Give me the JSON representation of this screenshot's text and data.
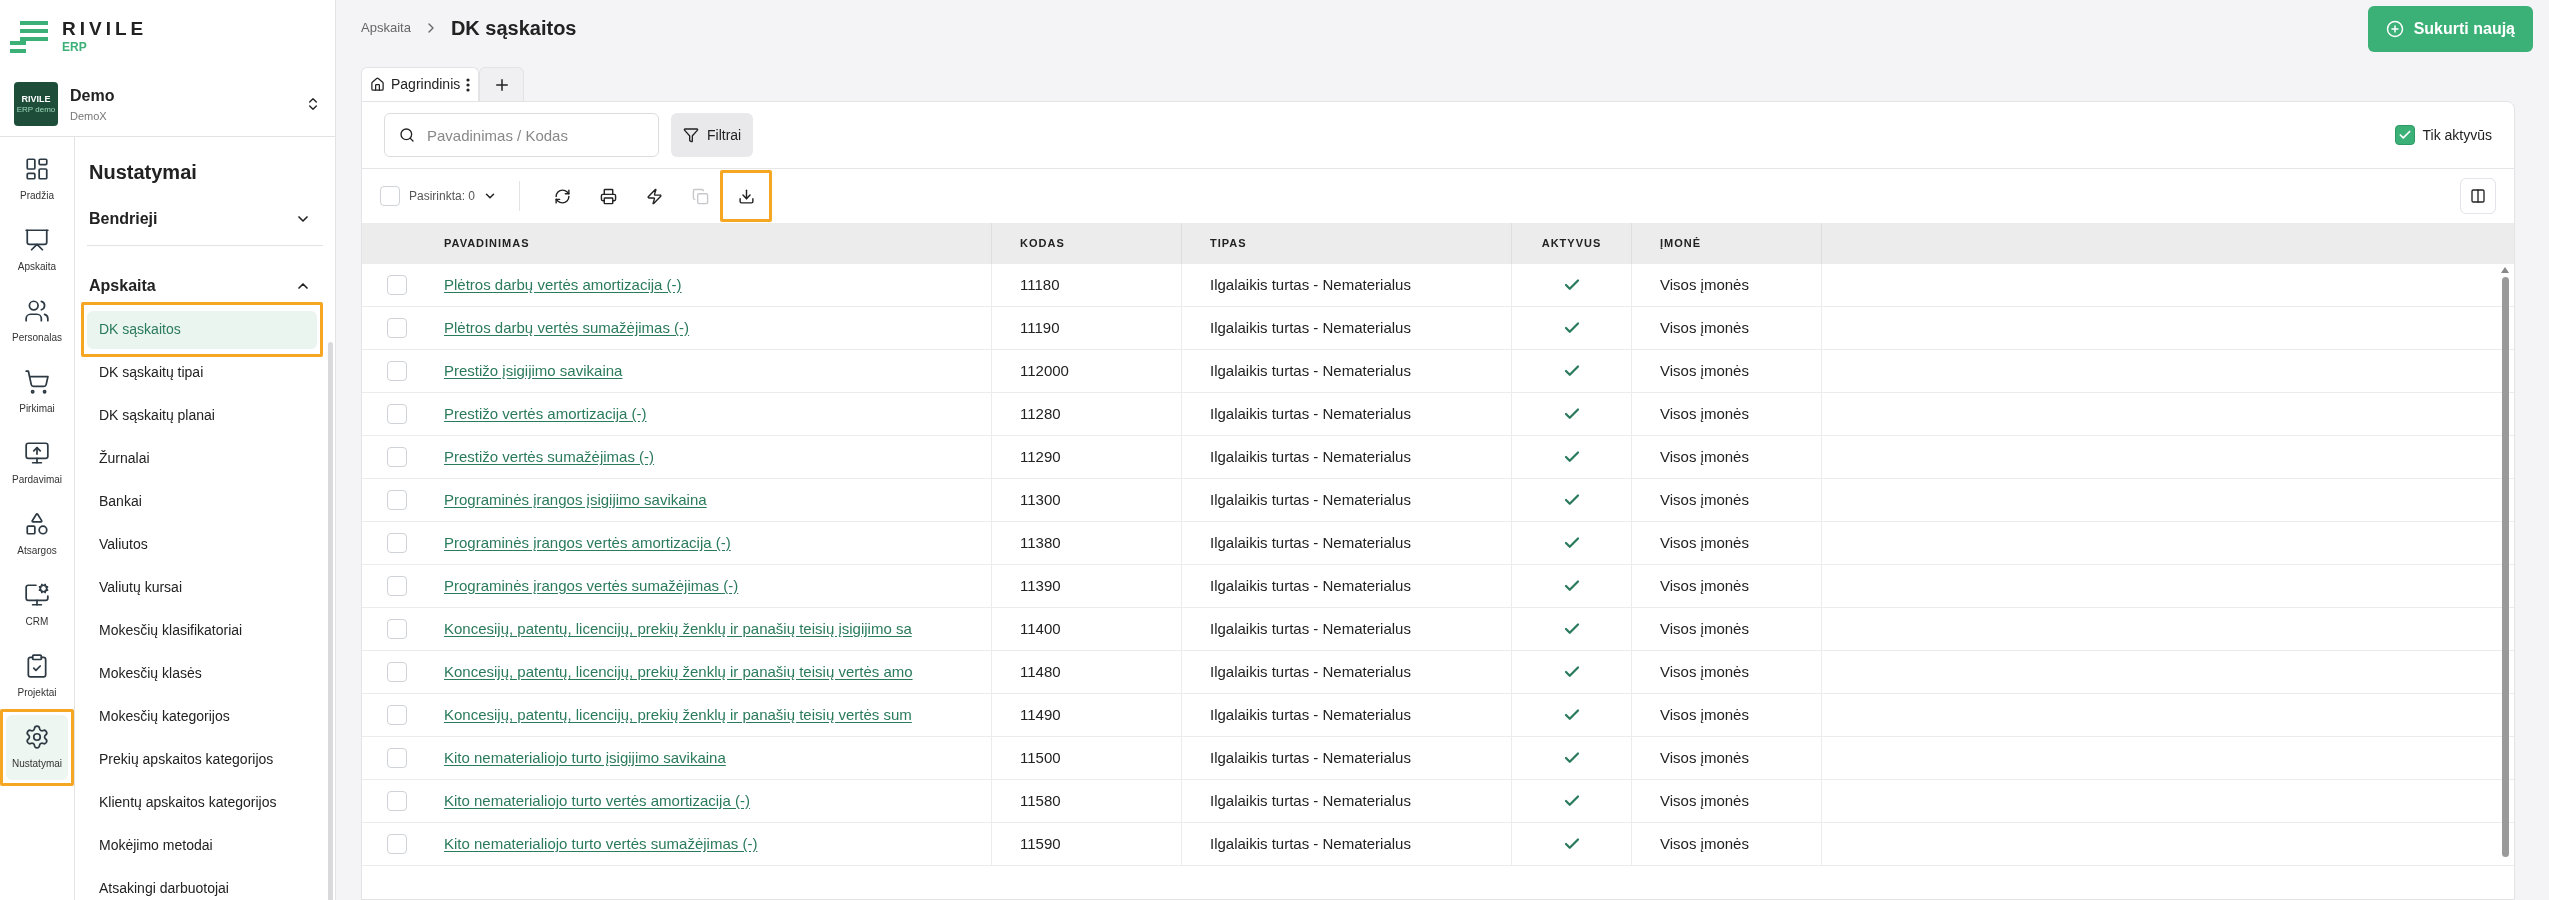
{
  "logo": {
    "name": "RIVILE",
    "sub": "ERP"
  },
  "company": {
    "name": "Demo",
    "sub": "DemoX",
    "logo_text": "RIVILE",
    "logo_caption": "ERP demo"
  },
  "rail": [
    {
      "kind": "dashboard",
      "label": "Pradžia",
      "selected": false,
      "highlighted": false
    },
    {
      "kind": "chart",
      "label": "Apskaita",
      "selected": false,
      "highlighted": false
    },
    {
      "kind": "people",
      "label": "Personalas",
      "selected": false,
      "highlighted": false
    },
    {
      "kind": "cart",
      "label": "Pirkimai",
      "selected": false,
      "highlighted": false
    },
    {
      "kind": "sales",
      "label": "Pardavimai",
      "selected": false,
      "highlighted": false
    },
    {
      "kind": "shapes",
      "label": "Atsargos",
      "selected": false,
      "highlighted": false
    },
    {
      "kind": "crm",
      "label": "CRM",
      "selected": false,
      "highlighted": false
    },
    {
      "kind": "projects",
      "label": "Projektai",
      "selected": false,
      "highlighted": false
    },
    {
      "kind": "settings",
      "label": "Nustatymai",
      "selected": true,
      "highlighted": true
    }
  ],
  "submenu": {
    "title": "Nustatymai",
    "sections": [
      {
        "label": "Bendrieji",
        "expanded": false
      },
      {
        "label": "Apskaita",
        "expanded": true,
        "items": [
          {
            "label": "DK sąskaitos",
            "selected": true,
            "highlighted": true
          },
          {
            "label": "DK sąskaitų tipai",
            "selected": false,
            "highlighted": false
          },
          {
            "label": "DK sąskaitų planai",
            "selected": false,
            "highlighted": false
          },
          {
            "label": "Žurnalai",
            "selected": false,
            "highlighted": false
          },
          {
            "label": "Bankai",
            "selected": false,
            "highlighted": false
          },
          {
            "label": "Valiutos",
            "selected": false,
            "highlighted": false
          },
          {
            "label": "Valiutų kursai",
            "selected": false,
            "highlighted": false
          },
          {
            "label": "Mokesčių klasifikatoriai",
            "selected": false,
            "highlighted": false
          },
          {
            "label": "Mokesčių klasės",
            "selected": false,
            "highlighted": false
          },
          {
            "label": "Mokesčių kategorijos",
            "selected": false,
            "highlighted": false
          },
          {
            "label": "Prekių apskaitos kategorijos",
            "selected": false,
            "highlighted": false
          },
          {
            "label": "Klientų apskaitos kategorijos",
            "selected": false,
            "highlighted": false
          },
          {
            "label": "Mokėjimo metodai",
            "selected": false,
            "highlighted": false
          },
          {
            "label": "Atsakingi darbuotojai",
            "selected": false,
            "highlighted": false
          }
        ]
      }
    ]
  },
  "breadcrumb": {
    "parent": "Apskaita",
    "current": "DK sąskaitos"
  },
  "create_button": "Sukurti naują",
  "tabs": [
    {
      "label": "Pagrindinis",
      "selected": true
    }
  ],
  "search": {
    "placeholder": "Pavadinimas / Kodas"
  },
  "filter_button": "Filtrai",
  "only_active": {
    "label": "Tik aktyvūs",
    "checked": true
  },
  "toolbar": {
    "select_all_checked": false,
    "selected_label": "Pasirinkta: 0",
    "actions": [
      {
        "kind": "refresh",
        "disabled": false,
        "highlighted": false
      },
      {
        "kind": "print",
        "disabled": false,
        "highlighted": false
      },
      {
        "kind": "bolt",
        "disabled": false,
        "highlighted": false
      },
      {
        "kind": "copy",
        "disabled": true,
        "highlighted": false
      },
      {
        "kind": "download",
        "disabled": false,
        "highlighted": true
      }
    ]
  },
  "table": {
    "columns": [
      "PAVADINIMAS",
      "KODAS",
      "TIPAS",
      "AKTYVUS",
      "ĮMONĖ"
    ],
    "rows": [
      {
        "checked": false,
        "name": "Plėtros darbų vertės amortizacija (-)",
        "code": "11180",
        "type": "Ilgalaikis turtas - Nematerialus",
        "active": true,
        "company": "Visos įmonės"
      },
      {
        "checked": false,
        "name": "Plėtros darbų vertės sumažėjimas (-)",
        "code": "11190",
        "type": "Ilgalaikis turtas - Nematerialus",
        "active": true,
        "company": "Visos įmonės"
      },
      {
        "checked": false,
        "name": "Prestižo įsigijimo savikaina",
        "code": "112000",
        "type": "Ilgalaikis turtas - Nematerialus",
        "active": true,
        "company": "Visos įmonės"
      },
      {
        "checked": false,
        "name": "Prestižo vertės amortizacija (-)",
        "code": "11280",
        "type": "Ilgalaikis turtas - Nematerialus",
        "active": true,
        "company": "Visos įmonės"
      },
      {
        "checked": false,
        "name": "Prestižo vertės sumažėjimas (-)",
        "code": "11290",
        "type": "Ilgalaikis turtas - Nematerialus",
        "active": true,
        "company": "Visos įmonės"
      },
      {
        "checked": false,
        "name": "Programinės įrangos įsigijimo savikaina",
        "code": "11300",
        "type": "Ilgalaikis turtas - Nematerialus",
        "active": true,
        "company": "Visos įmonės"
      },
      {
        "checked": false,
        "name": "Programinės įrangos vertės amortizacija (-)",
        "code": "11380",
        "type": "Ilgalaikis turtas - Nematerialus",
        "active": true,
        "company": "Visos įmonės"
      },
      {
        "checked": false,
        "name": "Programinės įrangos vertės sumažėjimas (-)",
        "code": "11390",
        "type": "Ilgalaikis turtas - Nematerialus",
        "active": true,
        "company": "Visos įmonės"
      },
      {
        "checked": false,
        "name": "Koncesijų, patentų, licencijų, prekių ženklų ir panašių teisių įsigijimo sa",
        "code": "11400",
        "type": "Ilgalaikis turtas - Nematerialus",
        "active": true,
        "company": "Visos įmonės"
      },
      {
        "checked": false,
        "name": "Koncesijų, patentų, licencijų, prekių ženklų ir panašių teisių vertės amo",
        "code": "11480",
        "type": "Ilgalaikis turtas - Nematerialus",
        "active": true,
        "company": "Visos įmonės"
      },
      {
        "checked": false,
        "name": "Koncesijų, patentų, licencijų, prekių ženklų ir panašių teisių vertės sum",
        "code": "11490",
        "type": "Ilgalaikis turtas - Nematerialus",
        "active": true,
        "company": "Visos įmonės"
      },
      {
        "checked": false,
        "name": "Kito nematerialiojo turto įsigijimo savikaina",
        "code": "11500",
        "type": "Ilgalaikis turtas - Nematerialus",
        "active": true,
        "company": "Visos įmonės"
      },
      {
        "checked": false,
        "name": "Kito nematerialiojo turto vertės amortizacija (-)",
        "code": "11580",
        "type": "Ilgalaikis turtas - Nematerialus",
        "active": true,
        "company": "Visos įmonės"
      },
      {
        "checked": false,
        "name": "Kito nematerialiojo turto vertės sumažėjimas (-)",
        "code": "11590",
        "type": "Ilgalaikis turtas - Nematerialus",
        "active": true,
        "company": "Visos įmonės"
      }
    ]
  }
}
